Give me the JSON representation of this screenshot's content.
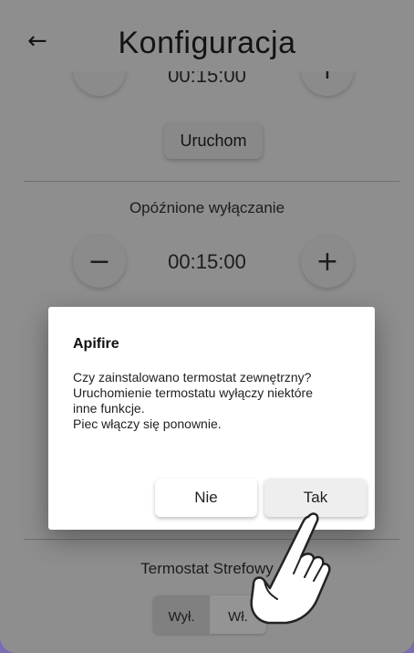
{
  "header": {
    "back_icon": "arrow-left-icon",
    "title": "Konfiguracja"
  },
  "background": {
    "timer_top": {
      "minus_label": "−",
      "plus_label": "+",
      "time": "00:15:00",
      "start_label": "Uruchom"
    },
    "delayed_shutdown": {
      "label": "Opóźnione wyłączanie",
      "minus_label": "−",
      "plus_label": "+",
      "time": "00:15:00"
    },
    "room_thermostat": {
      "label": "Termostat Strefowy",
      "off_label": "Wył.",
      "on_label": "Wł."
    }
  },
  "dialog": {
    "title": "Apifire",
    "lines": [
      "Czy zainstalowano termostat zewnętrzny?",
      "Uruchomienie termostatu wyłączy niektóre",
      "inne funkcje.",
      "Piec włączy się ponownie."
    ],
    "cancel_label": "Nie",
    "confirm_label": "Tak"
  },
  "overlay": {
    "pointer_icon": "pointing-hand-icon"
  },
  "colors": {
    "scrim": "#000000",
    "dialog_bg": "#ffffff",
    "app_bg": "#f4f4f4",
    "frame": "#7c6cb0"
  }
}
